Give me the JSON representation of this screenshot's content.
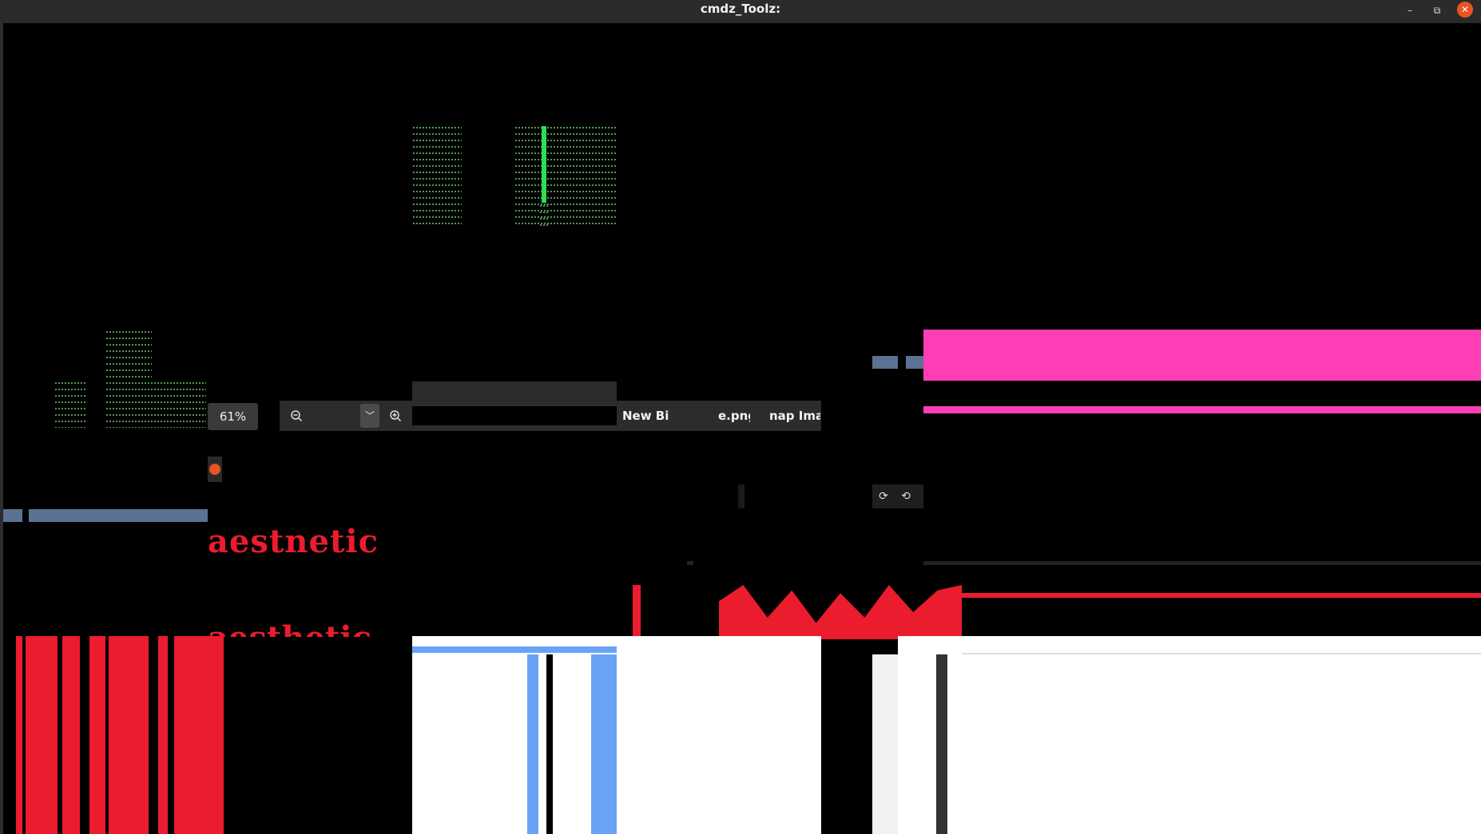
{
  "window": {
    "title": "cmdz_Toolz:",
    "minimize_label": "–",
    "restore_label": "⧉",
    "close_label": "✕"
  },
  "toolbar": {
    "zoom_level": "61%",
    "zoom_out_icon": "zoom-out-icon",
    "zoom_in_icon": "zoom-in-icon",
    "dropdown_icon": "chevron-down-icon",
    "tabs": [
      "New Bitr",
      "e.png",
      "nap Imag"
    ]
  },
  "rotate": {
    "rotate_left_icon": "rotate-left-icon",
    "rotate_right_icon": "rotate-right-icon"
  },
  "glitch_text": {
    "aesthetic": "aestnetic",
    "partial": "aesthetic"
  },
  "colors": {
    "accent_orange": "#e95420",
    "pink": "#ff3db5",
    "red": "#ea1c2d",
    "slate": "#5b7293",
    "green": "#2fdd55",
    "blue": "#6aa3f5"
  }
}
